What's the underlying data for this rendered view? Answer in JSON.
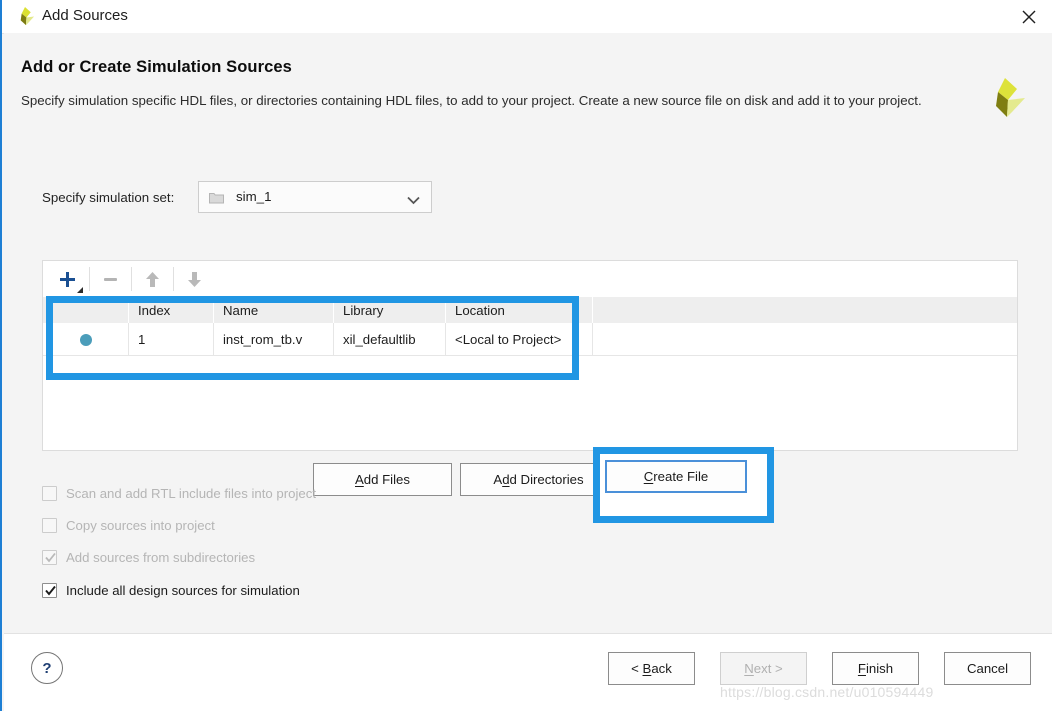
{
  "window": {
    "title": "Add Sources",
    "title_icon": "xilinx-logo-icon",
    "close_icon": "close-icon"
  },
  "page": {
    "heading": "Add or Create Simulation Sources",
    "description": "Specify simulation specific HDL files, or directories containing HDL files, to add to your project. Create a new source file on disk and add it to your project.",
    "brand_icon": "xilinx-logo-icon"
  },
  "simulation_set": {
    "label": "Specify simulation set:",
    "value": "sim_1",
    "folder_icon": "folder-icon",
    "dropdown_icon": "chevron-down-icon"
  },
  "toolbar": {
    "add": "+",
    "remove": "−",
    "move_up": "↑",
    "move_down": "↓",
    "add_icon": "plus-icon",
    "remove_icon": "minus-icon",
    "up_icon": "arrow-up-icon",
    "down_icon": "arrow-down-icon"
  },
  "table": {
    "columns": [
      "",
      "Index",
      "Name",
      "Library",
      "Location",
      ""
    ],
    "rows": [
      {
        "status_icon": "status-dot-icon",
        "index": "1",
        "name": "inst_rom_tb.v",
        "library": "xil_defaultlib",
        "location": "<Local to Project>"
      }
    ]
  },
  "actions": {
    "add_files": "Add Files",
    "add_directories": "Add Directories",
    "create_file": "Create File"
  },
  "options": [
    {
      "label": "Scan and add RTL include files into project",
      "checked": false,
      "enabled": false
    },
    {
      "label": "Copy sources into project",
      "checked": false,
      "enabled": false
    },
    {
      "label": "Add sources from subdirectories",
      "checked": true,
      "enabled": false
    },
    {
      "label": "Include all design sources for simulation",
      "checked": true,
      "enabled": true
    }
  ],
  "footer": {
    "help": "?",
    "back": "< Back",
    "next": "Next >",
    "finish": "Finish",
    "cancel": "Cancel"
  },
  "watermark": "https://blog.csdn.net/u010594449",
  "colors": {
    "highlight": "#2196e3",
    "status_dot": "#4b9dba",
    "accent_blue": "#1e7fd4"
  }
}
